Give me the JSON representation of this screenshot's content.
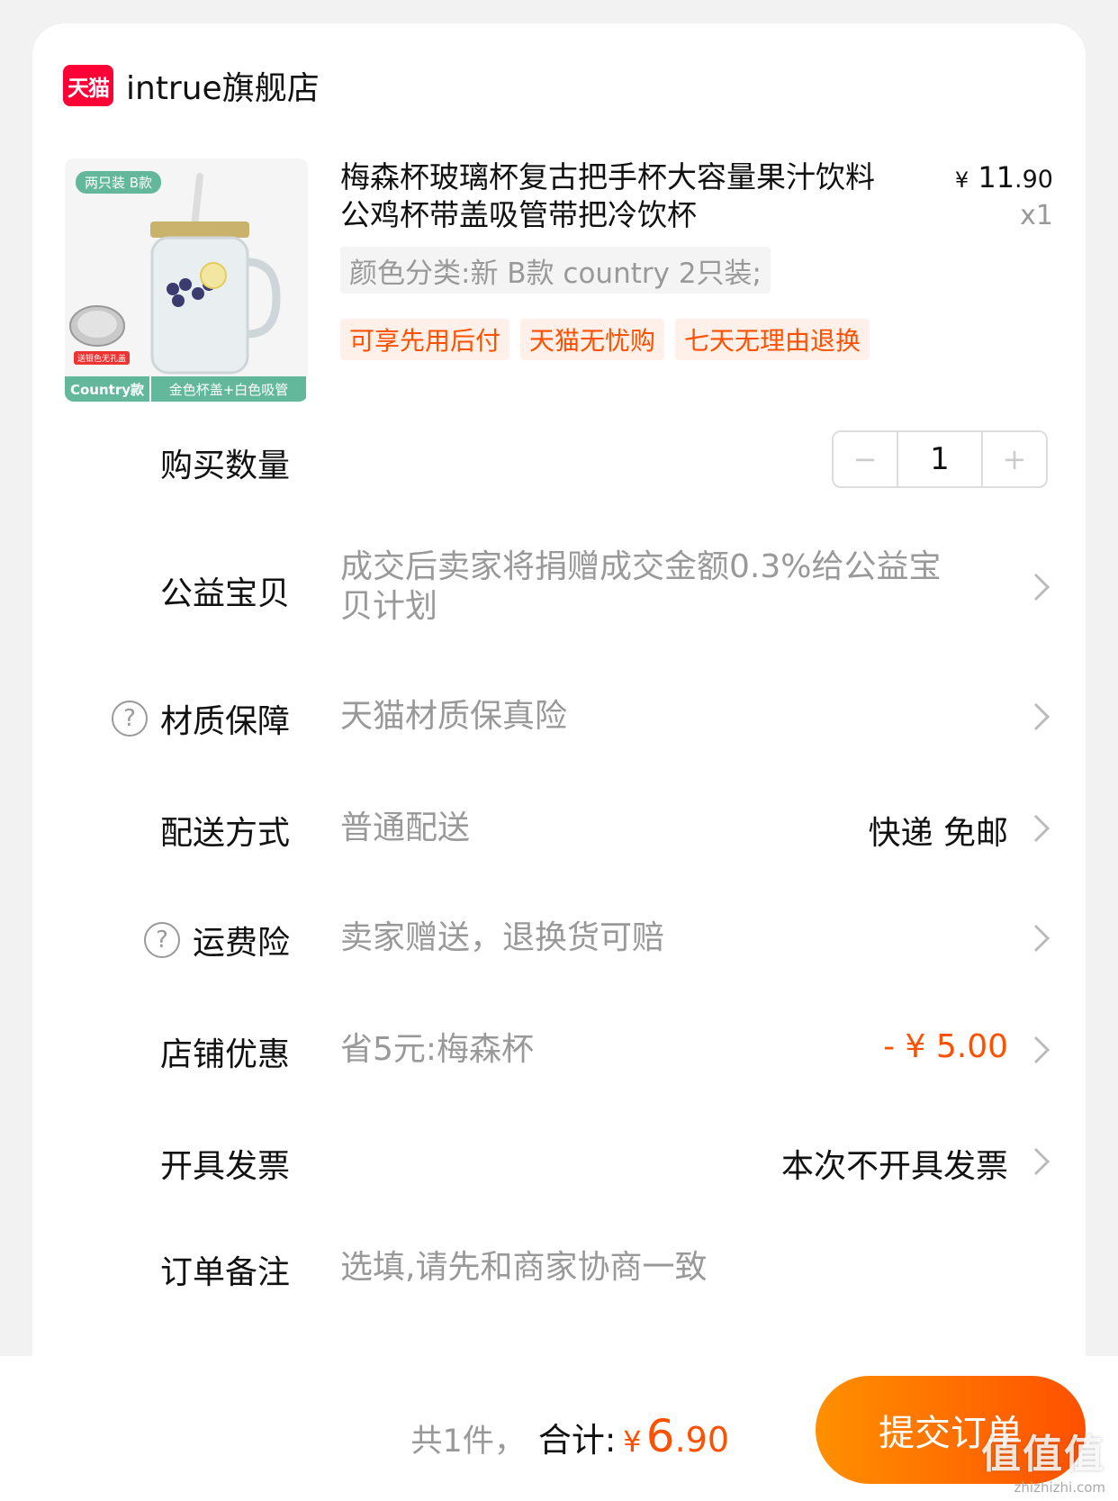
{
  "shop": {
    "logo_text": "天猫",
    "name": "intrue旗舰店"
  },
  "product": {
    "image_tag_top": "两只装 B款",
    "image_tag_bottom_1": "Country款",
    "image_tag_bottom_2": "金色杯盖+白色吸管",
    "image_lid_badge": "送银色无孔盖",
    "title": "梅森杯玻璃杯复古把手杯大容量果汁饮料公鸡杯带盖吸管带把冷饮杯",
    "price_currency": "¥",
    "price_int": "11",
    "price_dec": ".90",
    "qty": "x1",
    "sku": "颜色分类:新 B款 country 2只装;",
    "badges": [
      "可享先用后付",
      "天猫无忧购",
      "七天无理由退换"
    ]
  },
  "rows": {
    "quantity": {
      "label": "购买数量",
      "value": "1",
      "minus": "−",
      "plus": "+"
    },
    "charity": {
      "label": "公益宝贝",
      "value": "成交后卖家将捐赠成交金额0.3%给公益宝贝计划"
    },
    "material": {
      "label": "材质保障",
      "value": "天猫材质保真险"
    },
    "delivery": {
      "label": "配送方式",
      "value": "普通配送",
      "right": "快递 免邮"
    },
    "freight": {
      "label": "运费险",
      "value": "卖家赠送，退换货可赔"
    },
    "discount": {
      "label": "店铺优惠",
      "value": "省5元:梅森杯",
      "right": "- ¥ 5.00"
    },
    "invoice": {
      "label": "开具发票",
      "right": "本次不开具发票"
    },
    "note": {
      "label": "订单备注",
      "placeholder": "选填,请先和商家协商一致"
    }
  },
  "footer": {
    "count_text": "共1件，",
    "total_label": "合计:",
    "total_currency": "¥",
    "total_int": "6",
    "total_dec": ".90",
    "submit_label": "提交订单"
  },
  "watermark": {
    "brand": "值值值",
    "site": "zhizhizhi.com"
  },
  "colors": {
    "accent": "#ff5000",
    "tmall_red": "#ff0036",
    "badge_bg": "#fff1ea",
    "muted": "#999999"
  }
}
